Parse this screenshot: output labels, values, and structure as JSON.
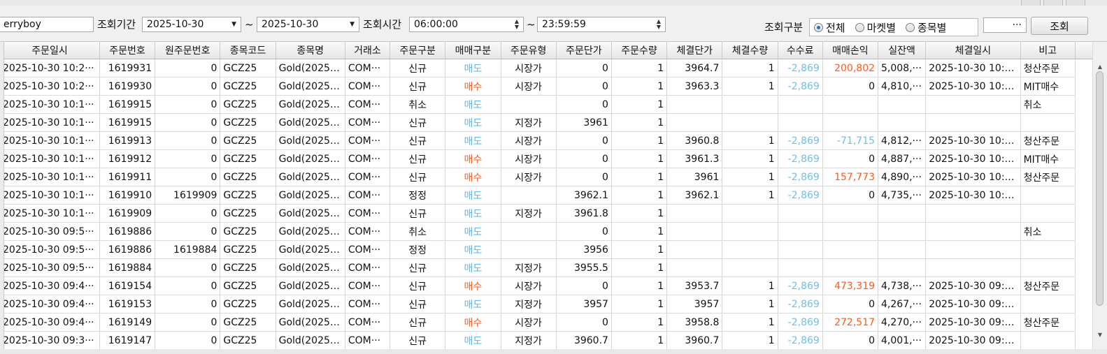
{
  "toolbar": {
    "account_value": "erryboy",
    "period_label": "조회기간",
    "date_from": "2025-10-30",
    "tilde1": "~",
    "date_to": "2025-10-30",
    "time_label": "조회시간",
    "time_from": "06:00:00",
    "tilde2": "~",
    "time_to": "23:59:59",
    "type_label": "조회구분",
    "radio_all": "전체",
    "radio_market": "마켓별",
    "radio_symbol": "종목별",
    "ellipsis": "···",
    "query_button": "조회"
  },
  "grid": {
    "columns": [
      "주문일시",
      "주문번호",
      "원주문번호",
      "종목코드",
      "종목명",
      "거래소",
      "주문구분",
      "매매구분",
      "주문유형",
      "주문단가",
      "주문수량",
      "체결단가",
      "체결수량",
      "수수료",
      "매매손익",
      "실잔액",
      "체결일시",
      "비고"
    ],
    "rows": [
      [
        "2025-10-30 10:2···",
        "1619931",
        "0",
        "GCZ25",
        "Gold(2025,···",
        "COM···",
        "신규",
        "매도",
        "시장가",
        "0",
        "1",
        "3964.7",
        "1",
        "-2,869",
        "200,802",
        "5,008,···",
        "2025-10-30 10:2···",
        "청산주문"
      ],
      [
        "2025-10-30 10:2···",
        "1619930",
        "0",
        "GCZ25",
        "Gold(2025,···",
        "COM···",
        "신규",
        "매수",
        "시장가",
        "0",
        "1",
        "3963.3",
        "1",
        "-2,869",
        "0",
        "4,810,···",
        "2025-10-30 10:2···",
        "MIT매수"
      ],
      [
        "2025-10-30 10:1···",
        "1619915",
        "0",
        "GCZ25",
        "Gold(2025,···",
        "COM···",
        "취소",
        "매도",
        "",
        "0",
        "1",
        "",
        "",
        "",
        "",
        "",
        "",
        "취소"
      ],
      [
        "2025-10-30 10:1···",
        "1619915",
        "0",
        "GCZ25",
        "Gold(2025,···",
        "COM···",
        "신규",
        "매도",
        "지정가",
        "3961",
        "1",
        "",
        "",
        "",
        "",
        "",
        "",
        ""
      ],
      [
        "2025-10-30 10:1···",
        "1619913",
        "0",
        "GCZ25",
        "Gold(2025,···",
        "COM···",
        "신규",
        "매도",
        "시장가",
        "0",
        "1",
        "3960.8",
        "1",
        "-2,869",
        "-71,715",
        "4,812,···",
        "2025-10-30 10:1···",
        "청산주문"
      ],
      [
        "2025-10-30 10:1···",
        "1619912",
        "0",
        "GCZ25",
        "Gold(2025,···",
        "COM···",
        "신규",
        "매수",
        "시장가",
        "0",
        "1",
        "3961.3",
        "1",
        "-2,869",
        "0",
        "4,887,···",
        "2025-10-30 10:1···",
        "MIT매수"
      ],
      [
        "2025-10-30 10:1···",
        "1619911",
        "0",
        "GCZ25",
        "Gold(2025,···",
        "COM···",
        "신규",
        "매수",
        "시장가",
        "0",
        "1",
        "3961",
        "1",
        "-2,869",
        "157,773",
        "4,890,···",
        "2025-10-30 10:1···",
        "청산주문"
      ],
      [
        "2025-10-30 10:1···",
        "1619910",
        "1619909",
        "GCZ25",
        "Gold(2025,···",
        "COM···",
        "정정",
        "매도",
        "",
        "3962.1",
        "1",
        "3962.1",
        "1",
        "-2,869",
        "0",
        "4,735,···",
        "2025-10-30 10:1···",
        ""
      ],
      [
        "2025-10-30 10:1···",
        "1619909",
        "0",
        "GCZ25",
        "Gold(2025,···",
        "COM···",
        "신규",
        "매도",
        "지정가",
        "3961.8",
        "1",
        "",
        "",
        "",
        "",
        "",
        "",
        ""
      ],
      [
        "2025-10-30 09:5···",
        "1619886",
        "0",
        "GCZ25",
        "Gold(2025,···",
        "COM···",
        "취소",
        "매도",
        "",
        "0",
        "1",
        "",
        "",
        "",
        "",
        "",
        "",
        "취소"
      ],
      [
        "2025-10-30 09:5···",
        "1619886",
        "1619884",
        "GCZ25",
        "Gold(2025,···",
        "COM···",
        "정정",
        "매도",
        "",
        "3956",
        "1",
        "",
        "",
        "",
        "",
        "",
        "",
        ""
      ],
      [
        "2025-10-30 09:5···",
        "1619884",
        "0",
        "GCZ25",
        "Gold(2025,···",
        "COM···",
        "신규",
        "매도",
        "지정가",
        "3955.5",
        "1",
        "",
        "",
        "",
        "",
        "",
        "",
        ""
      ],
      [
        "2025-10-30 09:4···",
        "1619154",
        "0",
        "GCZ25",
        "Gold(2025,···",
        "COM···",
        "신규",
        "매수",
        "시장가",
        "0",
        "1",
        "3953.7",
        "1",
        "-2,869",
        "473,319",
        "4,738,···",
        "2025-10-30 09:4···",
        "청산주문"
      ],
      [
        "2025-10-30 09:4···",
        "1619153",
        "0",
        "GCZ25",
        "Gold(2025,···",
        "COM···",
        "신규",
        "매도",
        "지정가",
        "3957",
        "1",
        "3957",
        "1",
        "-2,869",
        "0",
        "4,267,···",
        "2025-10-30 09:4···",
        ""
      ],
      [
        "2025-10-30 09:4···",
        "1619149",
        "0",
        "GCZ25",
        "Gold(2025,···",
        "COM···",
        "신규",
        "매수",
        "시장가",
        "0",
        "1",
        "3958.8",
        "1",
        "-2,869",
        "272,517",
        "4,270,···",
        "2025-10-30 09:4···",
        "청산주문"
      ],
      [
        "2025-10-30 09:3···",
        "1619147",
        "0",
        "GCZ25",
        "Gold(2025,···",
        "COM···",
        "신규",
        "매도",
        "지정가",
        "3960.7",
        "1",
        "3960.7",
        "1",
        "-2,869",
        "0",
        "4,001,···",
        "2025-10-30 09:3···",
        ""
      ]
    ]
  },
  "colors": {
    "buy": "#ff5a1a",
    "sell": "#5ab7ee",
    "fee": "#6fbfe8"
  },
  "icons": {
    "dropdown": "chevron-down-icon",
    "spinner": "spinner-arrows-icon",
    "scroll_up": "scroll-up-icon",
    "scroll_down": "scroll-down-icon"
  }
}
